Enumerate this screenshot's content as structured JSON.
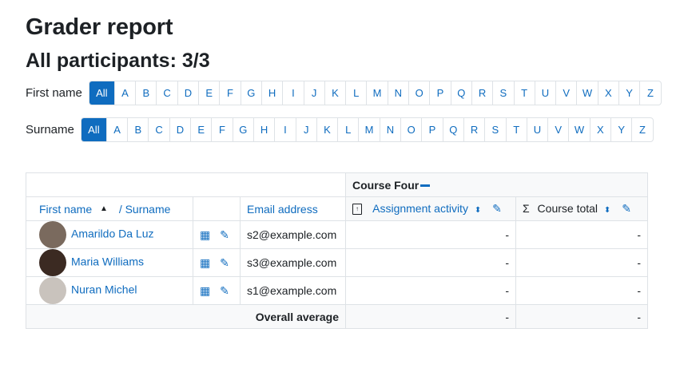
{
  "header": {
    "title": "Grader report",
    "subtitle": "All participants: 3/3"
  },
  "first_name_filter": {
    "label": "First name",
    "letters": [
      "All",
      "A",
      "B",
      "C",
      "D",
      "E",
      "F",
      "G",
      "H",
      "I",
      "J",
      "K",
      "L",
      "M",
      "N",
      "O",
      "P",
      "Q",
      "R",
      "S",
      "T",
      "U",
      "V",
      "W",
      "X",
      "Y",
      "Z"
    ],
    "selected": "All"
  },
  "surname_filter": {
    "label": "Surname",
    "letters": [
      "All",
      "A",
      "B",
      "C",
      "D",
      "E",
      "F",
      "G",
      "H",
      "I",
      "J",
      "K",
      "L",
      "M",
      "N",
      "O",
      "P",
      "Q",
      "R",
      "S",
      "T",
      "U",
      "V",
      "W",
      "X",
      "Y",
      "Z"
    ],
    "selected": "All"
  },
  "table": {
    "course_name": "Course Four",
    "columns": {
      "first_name": "First name",
      "surname": "/ Surname",
      "email": "Email address",
      "assignment": "Assignment activity",
      "course_total": "Course total"
    },
    "rows": [
      {
        "name": "Amarildo Da Luz",
        "email": "s2@example.com",
        "assignment": "-",
        "total": "-",
        "avatar_color": "#7a6a5e"
      },
      {
        "name": "Maria Williams",
        "email": "s3@example.com",
        "assignment": "-",
        "total": "-",
        "avatar_color": "#3b2a22"
      },
      {
        "name": "Nuran Michel",
        "email": "s1@example.com",
        "assignment": "-",
        "total": "-",
        "avatar_color": "#c9c3bd"
      }
    ],
    "footer": {
      "label": "Overall average",
      "assignment": "-",
      "total": "-"
    }
  },
  "colors": {
    "accent": "#0f6cbf",
    "border": "#dee2e6"
  }
}
